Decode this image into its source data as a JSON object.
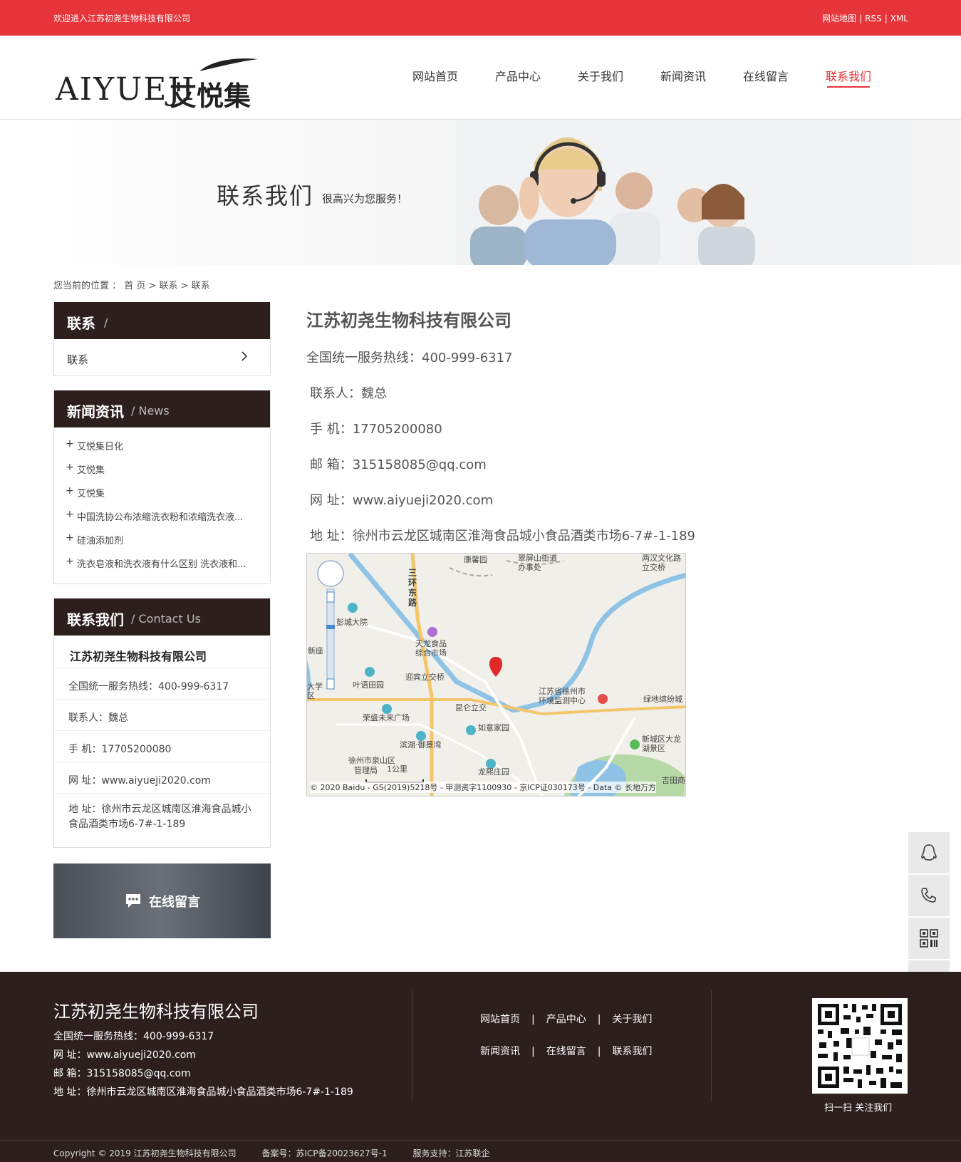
{
  "topbar": {
    "welcome": "欢迎进入江苏初尧生物科技有限公司",
    "links": [
      "网站地图",
      "RSS",
      "XML"
    ]
  },
  "logo": {
    "latin": "AIYUEJI",
    "cn": "艾悦集"
  },
  "nav": [
    {
      "label": "网站首页"
    },
    {
      "label": "产品中心"
    },
    {
      "label": "关于我们"
    },
    {
      "label": "新闻资讯"
    },
    {
      "label": "在线留言"
    },
    {
      "label": "联系我们",
      "active": true
    }
  ],
  "banner": {
    "title": "联系我们",
    "subtitle": "很高兴为您服务！"
  },
  "breadcrumb": {
    "text": "您当前的位置 ： 首 页 > 联系 > 联系"
  },
  "sidebar": {
    "box1": {
      "title": "联系",
      "title_suffix": "/",
      "item": "联系"
    },
    "box2": {
      "title": "新闻资讯",
      "en": "/ News",
      "items": [
        "艾悦集日化",
        "艾悦集",
        "艾悦集",
        "中国洗协公布浓缩洗衣粉和浓缩洗衣液...",
        "硅油添加剂",
        "洗衣皂液和洗衣液有什么区别 洗衣液和..."
      ]
    },
    "box3": {
      "title": "联系我们",
      "en": "/ Contact Us",
      "company": "江苏初尧生物科技有限公司",
      "lines": [
        "全国统一服务热线：400-999-6317",
        "联系人：魏总",
        "手 机：17705200080",
        "网  址：www.aiyueji2020.com",
        "地  址：徐州市云龙区城南区淮海食品城小食品酒类市场6-7#-1-189"
      ]
    },
    "message_button": "在线留言"
  },
  "main": {
    "company": "江苏初尧生物科技有限公司",
    "hotline": "全国统一服务热线：400-999-6317",
    "contact": "联系人：魏总",
    "mobile": "手 机：17705200080",
    "email": "邮  箱：315158085@qq.com",
    "website": "网  址：www.aiyueji2020.com",
    "address": "地  址：徐州市云龙区城南区淮海食品城小食品酒类市场6-7#-1-189"
  },
  "map": {
    "labels": [
      "康馨园",
      "翠屏山街道办事处",
      "两汉文化路立交桥",
      "三环东路",
      "彭城大院",
      "天龙食品综合市场",
      "迎宾立交桥",
      "新座",
      "叶语田园",
      "大学区",
      "江苏省徐州市环境监测中心",
      "绿地缤纷城",
      "荣盛未来广场",
      "昆仑立交",
      "如意家园",
      "滨湖·御景湾",
      "新城区大龙湖景区",
      "徐州市泉山区",
      "管理局",
      "龙熙庄园",
      "吉田商"
    ],
    "scale": "1公里",
    "copyright": "© 2020 Baidu - GS(2019)5218号 - 甲测资字1100930 - 京ICP证030173号 - Data © 长地万方"
  },
  "footer": {
    "company": "江苏初尧生物科技有限公司",
    "hotline": "全国统一服务热线：400-999-6317",
    "website": "网 址：www.aiyueji2020.com",
    "email": "邮 箱：315158085@qq.com",
    "address": "地 址：徐州市云龙区城南区淮海食品城小食品酒类市场6-7#-1-189",
    "links_row1": [
      "网站首页",
      "产品中心",
      "关于我们"
    ],
    "links_row2": [
      "新闻资讯",
      "在线留言",
      "联系我们"
    ],
    "qr_label": "扫一扫 关注我们",
    "copyright": "Copyright © 2019 江苏初尧生物科技有限公司",
    "icp": "备案号：苏ICP备20023627号-1",
    "support": "服务支持：江苏联企"
  },
  "colors": {
    "accent": "#e5353a",
    "dark": "#2d1f1e"
  }
}
